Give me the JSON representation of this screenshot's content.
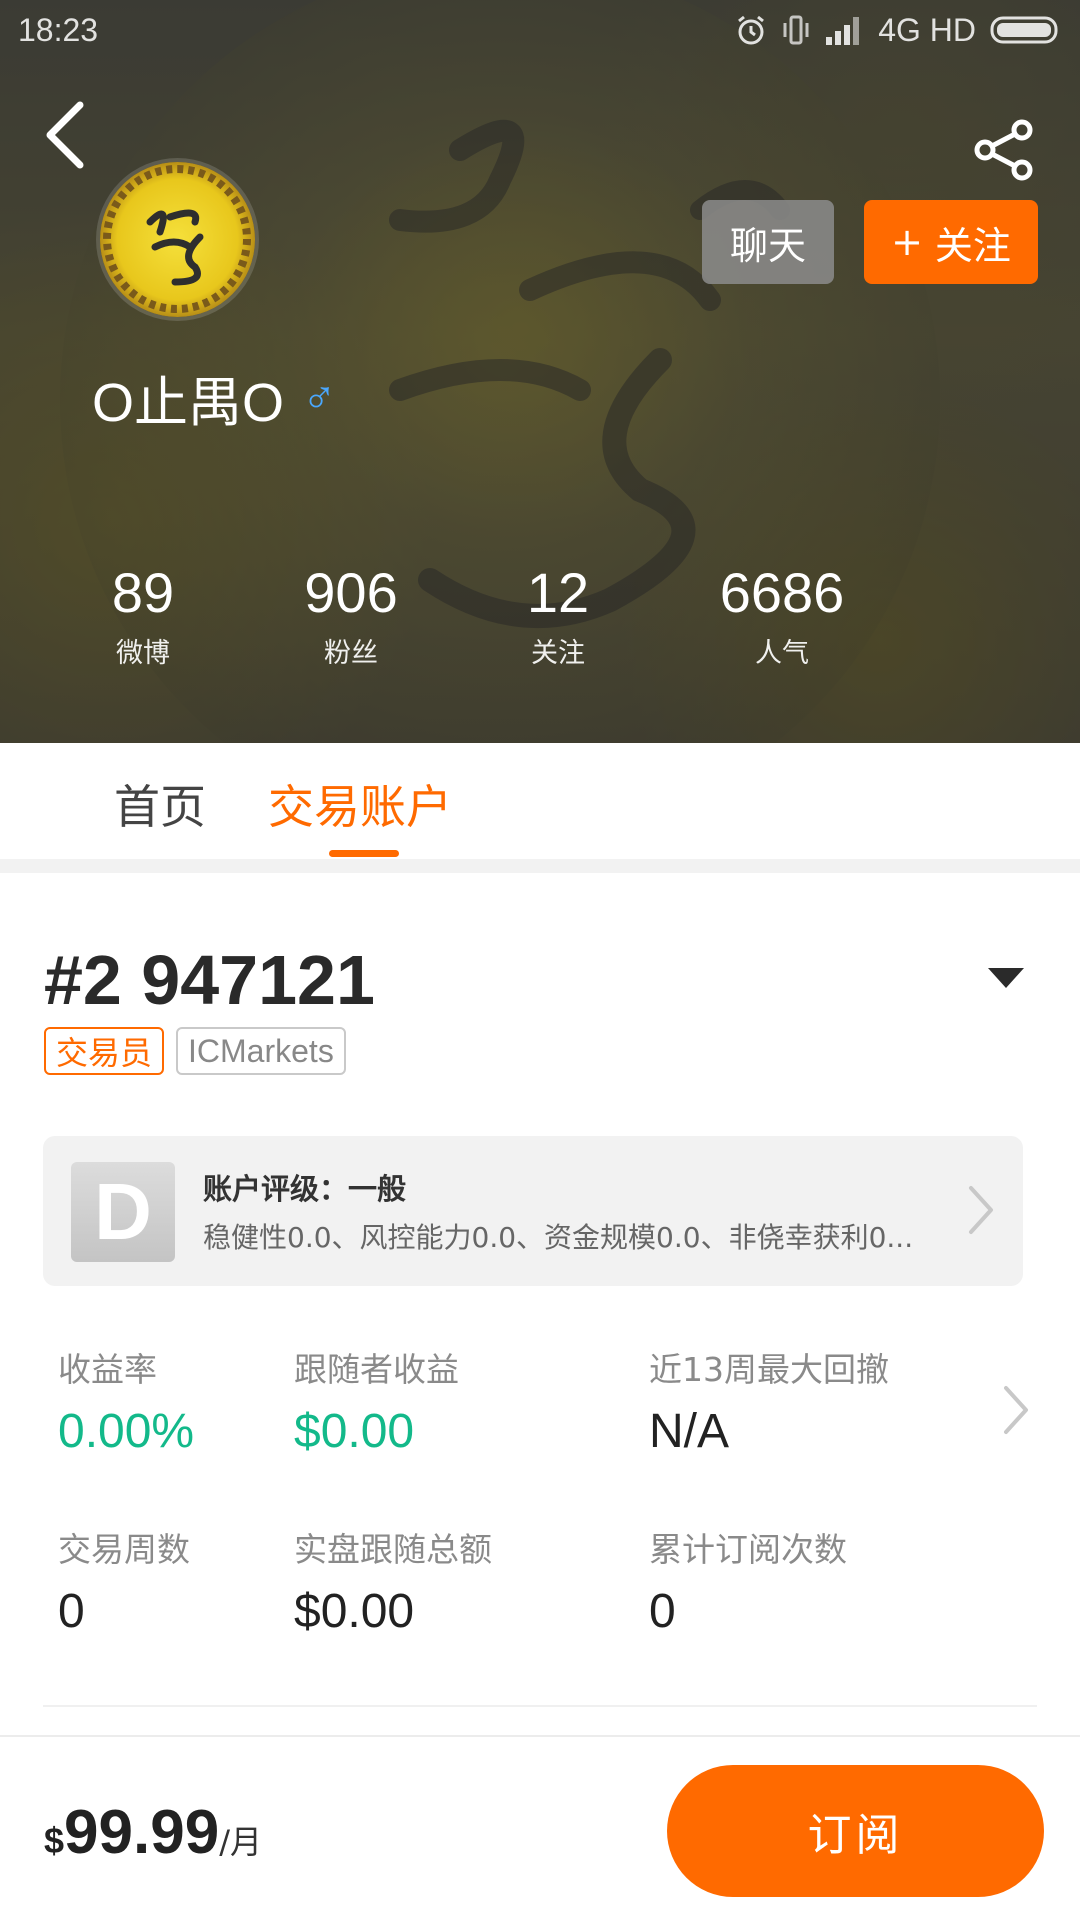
{
  "status_bar": {
    "time": "18:23",
    "network": "4G HD",
    "icons": [
      "alarm-icon",
      "vibrate-icon",
      "signal-icon",
      "battery-icon"
    ]
  },
  "header": {
    "back_icon": "chevron-left-icon",
    "share_icon": "share-icon",
    "chat_label": "聊天",
    "follow_plus": "+",
    "follow_label": "关注",
    "username": "O止禺O",
    "gender_symbol": "♂",
    "gender_color": "#4aa8ff"
  },
  "stats": [
    {
      "value": "89",
      "label": "微博"
    },
    {
      "value": "906",
      "label": "粉丝"
    },
    {
      "value": "12",
      "label": "关注"
    },
    {
      "value": "6686",
      "label": "人气"
    }
  ],
  "tabs": [
    {
      "label": "首页",
      "active": false
    },
    {
      "label": "交易账户",
      "active": true
    }
  ],
  "account": {
    "id": "#2 947121",
    "role_badge": "交易员",
    "broker_badge": "ICMarkets",
    "dropdown_icon": "triangle-down-icon"
  },
  "rating": {
    "grade": "D",
    "title": "账户评级：一般",
    "description": "稳健性0.0、风控能力0.0、资金规模0.0、非侥幸获利0..."
  },
  "metrics": [
    {
      "label": "收益率",
      "value": "0.00%",
      "color": "#13b98a"
    },
    {
      "label": "跟随者收益",
      "value": "$0.00",
      "color": "#13b98a"
    },
    {
      "label": "近13周最大回撤",
      "value": "N/A",
      "color": "#222222"
    },
    {
      "label": "交易周数",
      "value": "0",
      "color": "#222222"
    },
    {
      "label": "实盘跟随总额",
      "value": "$0.00",
      "color": "#222222"
    },
    {
      "label": "累计订阅次数",
      "value": "0",
      "color": "#222222"
    }
  ],
  "footer": {
    "currency": "$",
    "price": "99.99",
    "unit": "/月",
    "subscribe_label": "订阅"
  },
  "colors": {
    "accent": "#ff6a00",
    "positive": "#13b98a"
  }
}
